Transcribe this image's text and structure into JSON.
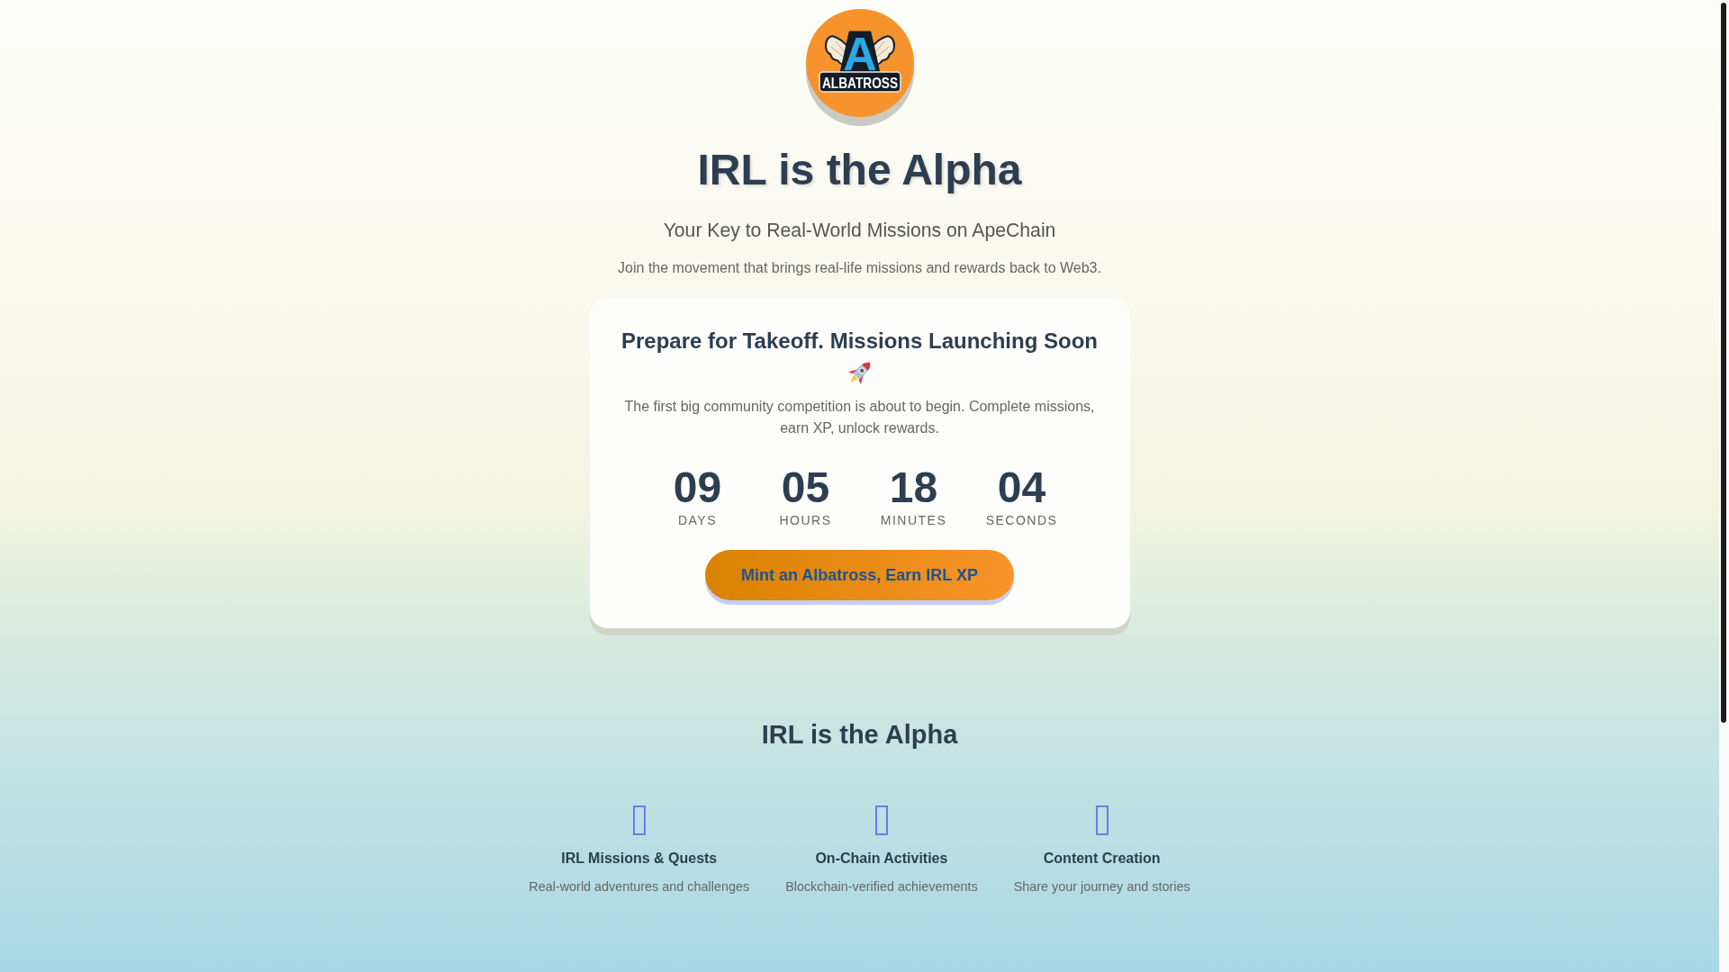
{
  "logo": {
    "letter": "A",
    "wordmark": "ALBATROSS"
  },
  "hero": {
    "title": "IRL is the Alpha",
    "subtitle": "Your Key to Real-World Missions on ApeChain",
    "tagline": "Join the movement that brings real-life missions and rewards back to Web3."
  },
  "launch_card": {
    "heading": "Prepare for Takeoff. Missions Launching Soon",
    "text": "The first big community competition is about to begin. Complete missions, earn XP, unlock rewards.",
    "countdown": [
      {
        "value": "09",
        "unit": "DAYS"
      },
      {
        "value": "05",
        "unit": "HOURS"
      },
      {
        "value": "18",
        "unit": "MINUTES"
      },
      {
        "value": "04",
        "unit": "SECONDS"
      }
    ],
    "button": "Mint an Albatross, Earn IRL XP"
  },
  "features_section": {
    "title": "IRL is the Alpha",
    "features": [
      {
        "title": "IRL Missions & Quests",
        "description": "Real-world adventures and challenges"
      },
      {
        "title": "On-Chain Activities",
        "description": "Blockchain-verified achievements"
      },
      {
        "title": "Content Creation",
        "description": "Share your journey and stories"
      }
    ]
  }
}
